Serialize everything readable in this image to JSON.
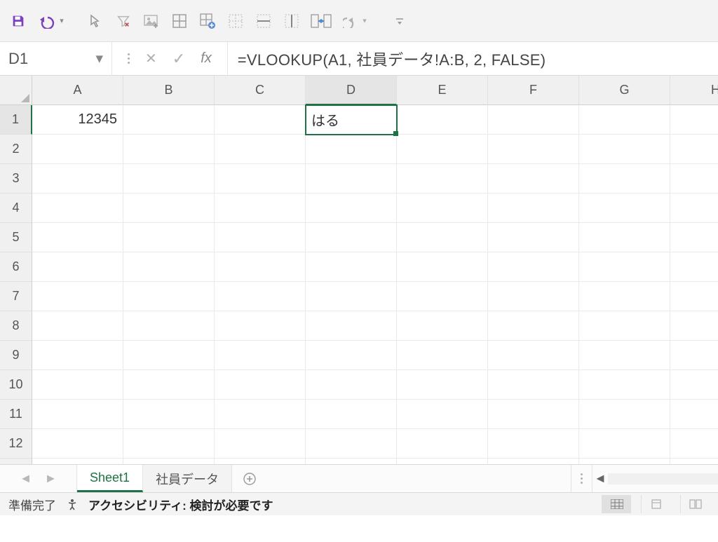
{
  "toolbar": {
    "icons": [
      "save",
      "undo",
      "pointer",
      "filter-clear",
      "picture",
      "border-all",
      "table-magic",
      "border-dash",
      "border-center",
      "border-split",
      "border-merge",
      "redo",
      "more"
    ]
  },
  "namebox": {
    "value": "D1"
  },
  "formula_bar": {
    "fx_label": "fx",
    "formula": "=VLOOKUP(A1, 社員データ!A:B, 2, FALSE)"
  },
  "grid": {
    "columns": [
      "A",
      "B",
      "C",
      "D",
      "E",
      "F",
      "G",
      "H"
    ],
    "row_count": 13,
    "selected_cell": "D1",
    "selected_col": "D",
    "selected_row": 1,
    "cells": {
      "A1": {
        "value": "12345",
        "align": "right"
      },
      "D1": {
        "value": "はる",
        "align": "left"
      }
    }
  },
  "tabs": {
    "items": [
      {
        "name": "Sheet1",
        "active": true
      },
      {
        "name": "社員データ",
        "active": false
      }
    ],
    "add_label": "⊕"
  },
  "status": {
    "ready": "準備完了",
    "accessibility_label": "アクセシビリティ: 検討が必要です"
  }
}
